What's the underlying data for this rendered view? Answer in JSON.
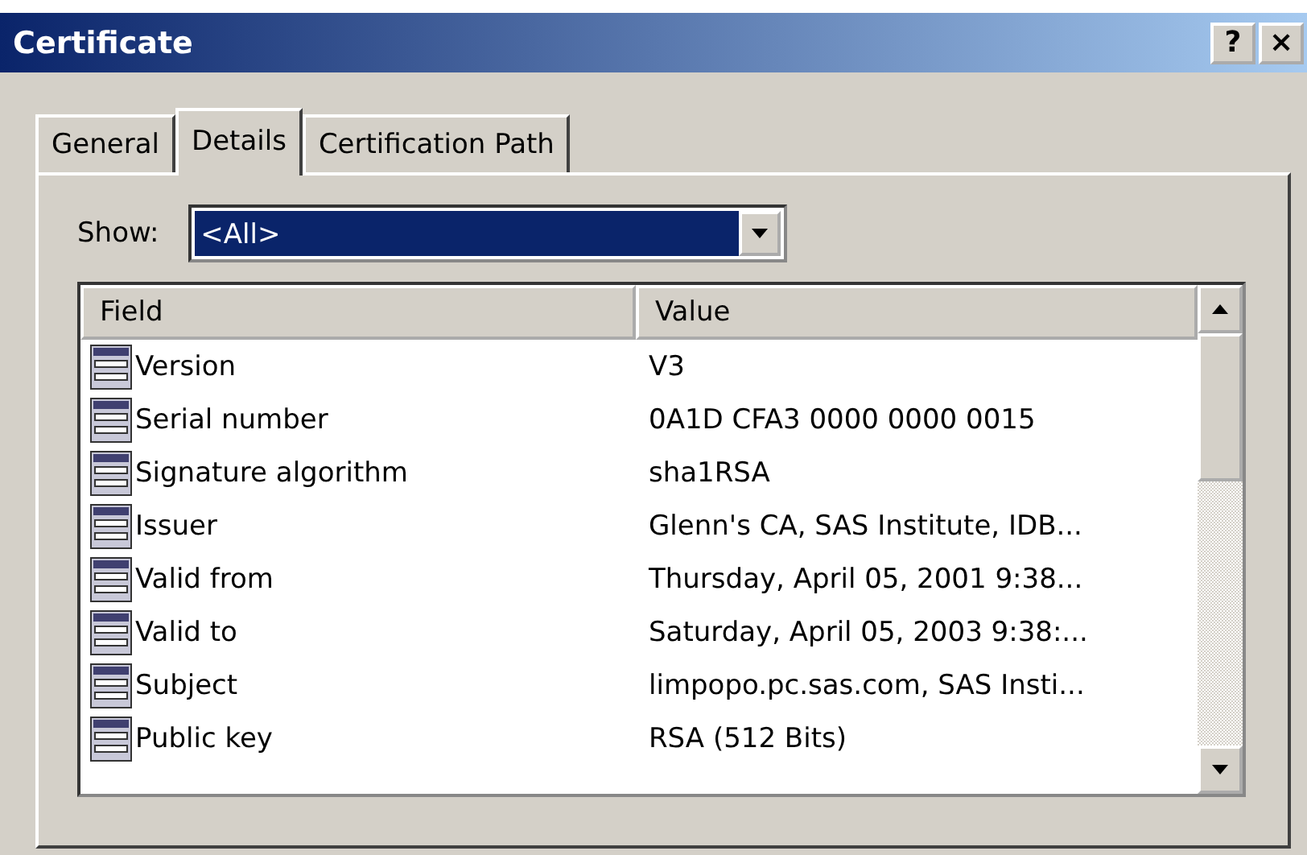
{
  "window": {
    "title": "Certificate",
    "buttons": [
      "?",
      "×"
    ]
  },
  "tabs": [
    {
      "label": "General",
      "selected": false
    },
    {
      "label": "Details",
      "selected": true
    },
    {
      "label": "Certification Path",
      "selected": false
    }
  ],
  "show": {
    "label": "Show:",
    "value": "<All>"
  },
  "table": {
    "columns": [
      "Field",
      "Value"
    ],
    "rows": [
      {
        "field": "Version",
        "value": "V3"
      },
      {
        "field": "Serial number",
        "value": "0A1D CFA3 0000 0000 0015"
      },
      {
        "field": "Signature algorithm",
        "value": "sha1RSA"
      },
      {
        "field": "Issuer",
        "value": "Glenn's CA, SAS Institute, IDB..."
      },
      {
        "field": "Valid from",
        "value": "Thursday, April 05, 2001 9:38..."
      },
      {
        "field": "Valid to",
        "value": "Saturday, April 05, 2003 9:38:..."
      },
      {
        "field": "Subject",
        "value": "limpopo.pc.sas.com, SAS Insti..."
      },
      {
        "field": "Public key",
        "value": "RSA (512 Bits)"
      }
    ]
  }
}
